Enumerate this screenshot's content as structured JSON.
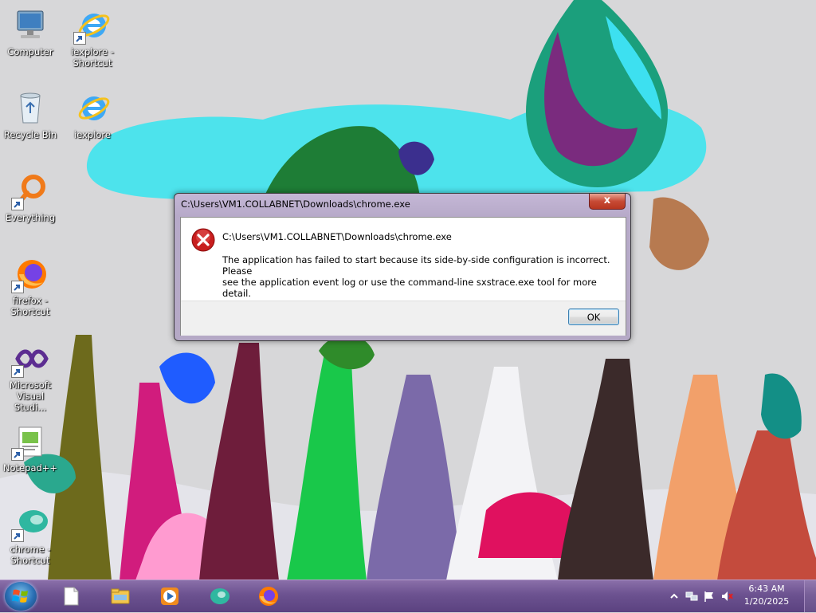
{
  "desktop": {
    "icons": [
      {
        "label_1": "Computer",
        "label_2": ""
      },
      {
        "label_1": "iexplore -",
        "label_2": "Shortcut"
      },
      {
        "label_1": "Recycle Bin",
        "label_2": ""
      },
      {
        "label_1": "iexplore",
        "label_2": ""
      },
      {
        "label_1": "Everything",
        "label_2": ""
      },
      {
        "label_1": "firefox -",
        "label_2": "Shortcut"
      },
      {
        "label_1": "Microsoft",
        "label_2": "Visual Studi..."
      },
      {
        "label_1": "Notepad++",
        "label_2": ""
      },
      {
        "label_1": "chrome -",
        "label_2": "Shortcut"
      }
    ]
  },
  "dialog": {
    "title": "C:\\Users\\VM1.COLLABNET\\Downloads\\chrome.exe",
    "close_label": "x",
    "path": "C:\\Users\\VM1.COLLABNET\\Downloads\\chrome.exe",
    "message_line1": "The application has failed to start because its side-by-side configuration is incorrect. Please",
    "message_line2": "see the application event log or use the command-line sxstrace.exe tool for more detail.",
    "ok_label": "OK",
    "icon": "error-icon"
  },
  "taskbar": {
    "start_icon": "windows-logo-icon",
    "pinned": [
      "file-icon",
      "explorer-folder-icon",
      "media-player-icon",
      "chrome-icon",
      "firefox-icon"
    ],
    "tray": {
      "icons": [
        "chevron-up-icon",
        "network-icon",
        "flag-icon",
        "speaker-muted-icon"
      ],
      "time": "6:43 AM",
      "date": "1/20/2025"
    }
  },
  "colors": {
    "taskbar": "#6c5290",
    "dialog_frame": "#b7aac9",
    "error_red": "#c81e1e",
    "ok_border": "#3c7fb1"
  }
}
